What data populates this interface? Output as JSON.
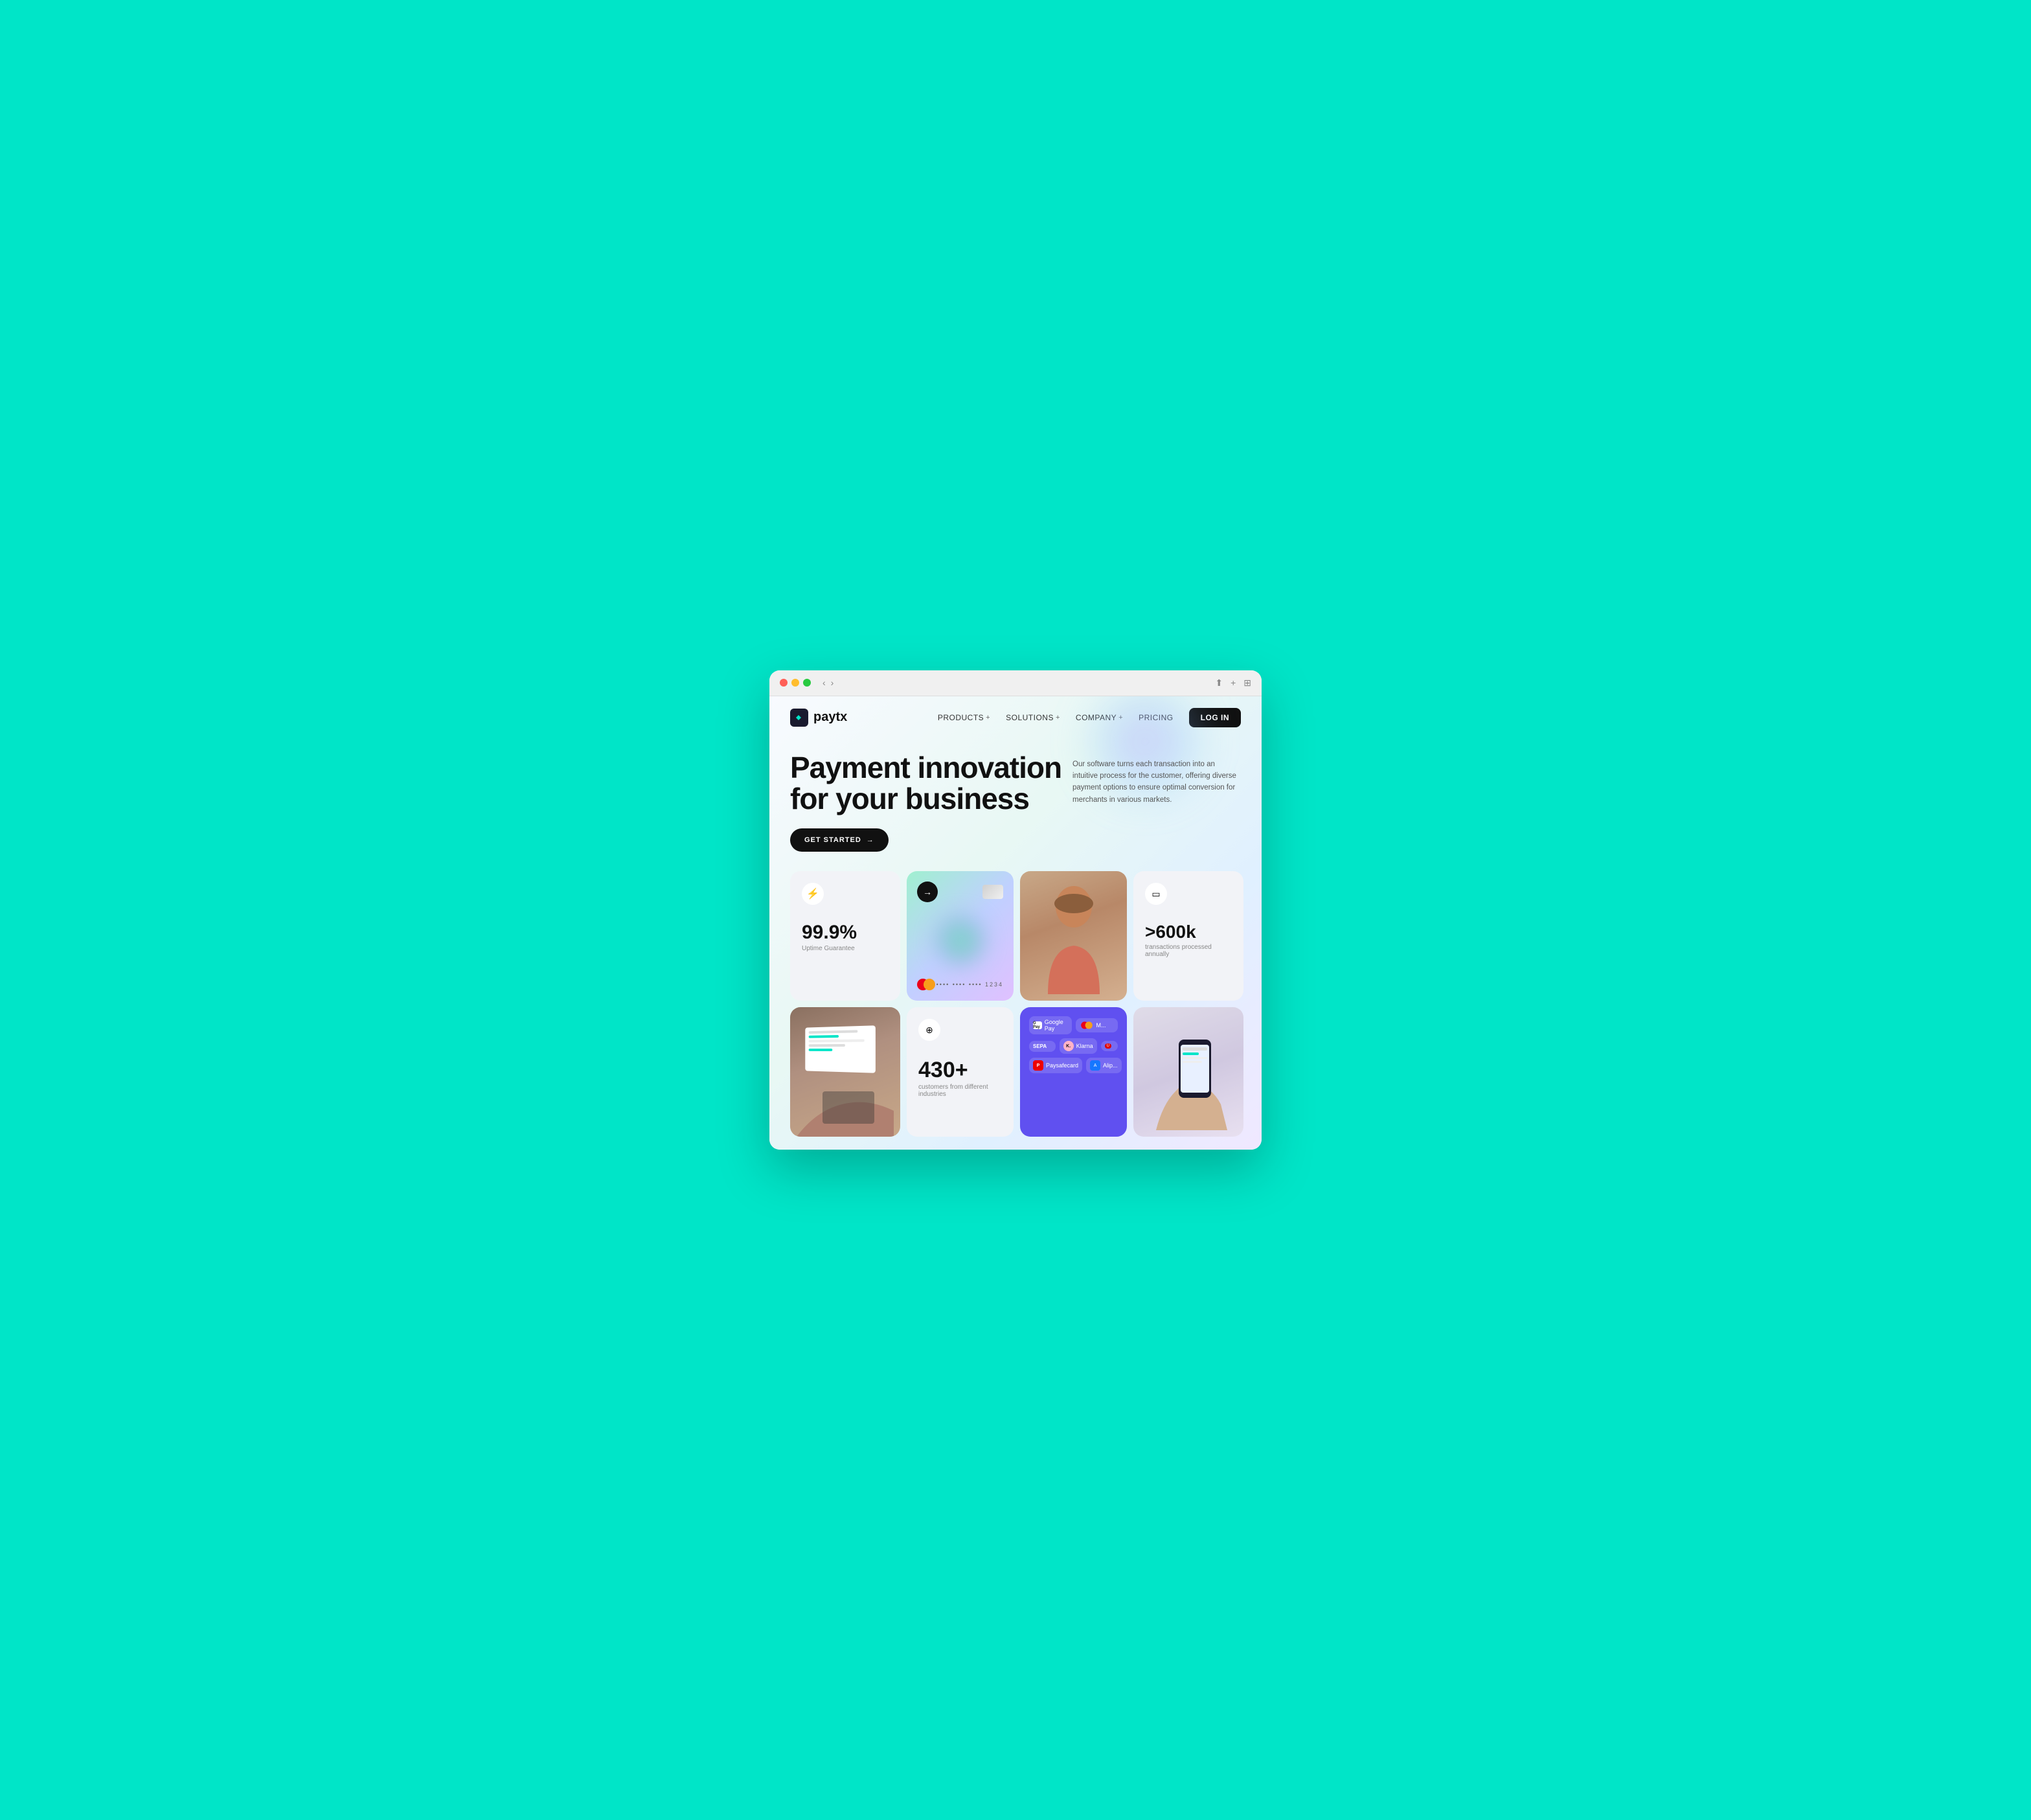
{
  "browser": {
    "dots": [
      "red",
      "yellow",
      "green"
    ],
    "nav_back": "‹",
    "nav_forward": "›"
  },
  "navbar": {
    "logo_text": "paytx",
    "links": [
      {
        "label": "PRODUCTS",
        "has_plus": true
      },
      {
        "label": "SOLUTIONS",
        "has_plus": true
      },
      {
        "label": "COMPANY",
        "has_plus": true
      },
      {
        "label": "PRICING",
        "has_plus": false
      }
    ],
    "login_label": "LOG IN"
  },
  "hero": {
    "title_line1": "Payment innovation",
    "title_line2": "for your business",
    "cta_label": "GET STARTED",
    "description": "Our software turns each transaction into an intuitive process for the customer, offering diverse payment options to ensure optimal conversion for merchants in various markets."
  },
  "cards": {
    "uptime": {
      "icon": "⚡",
      "number": "99.9%",
      "label": "Uptime Guarantee"
    },
    "transactions": {
      "icon": "▭",
      "number": ">600k",
      "label": "transactions processed annually"
    },
    "customers": {
      "icon": "⊕",
      "number": "430+",
      "label": "customers from different industries"
    },
    "credit_card": {
      "number": "•••• •••• •••• 1234"
    },
    "payment_methods": {
      "row1": [
        {
          "name": "Google Pay",
          "icon": "G"
        },
        {
          "name": "Mastercard",
          "icon": "MC"
        }
      ],
      "row2": [
        {
          "name": "SEPA",
          "icon": "SEPA"
        },
        {
          "name": "Klarna",
          "icon": "K"
        }
      ],
      "row3": [
        {
          "name": "Paysafecard",
          "icon": "P"
        },
        {
          "name": "Alipay",
          "icon": "A"
        }
      ]
    }
  },
  "colors": {
    "bg_teal": "#00E5C8",
    "accent_dark": "#111111",
    "card_bg": "#f2f3f7",
    "payment_bg": "#6050f0"
  }
}
